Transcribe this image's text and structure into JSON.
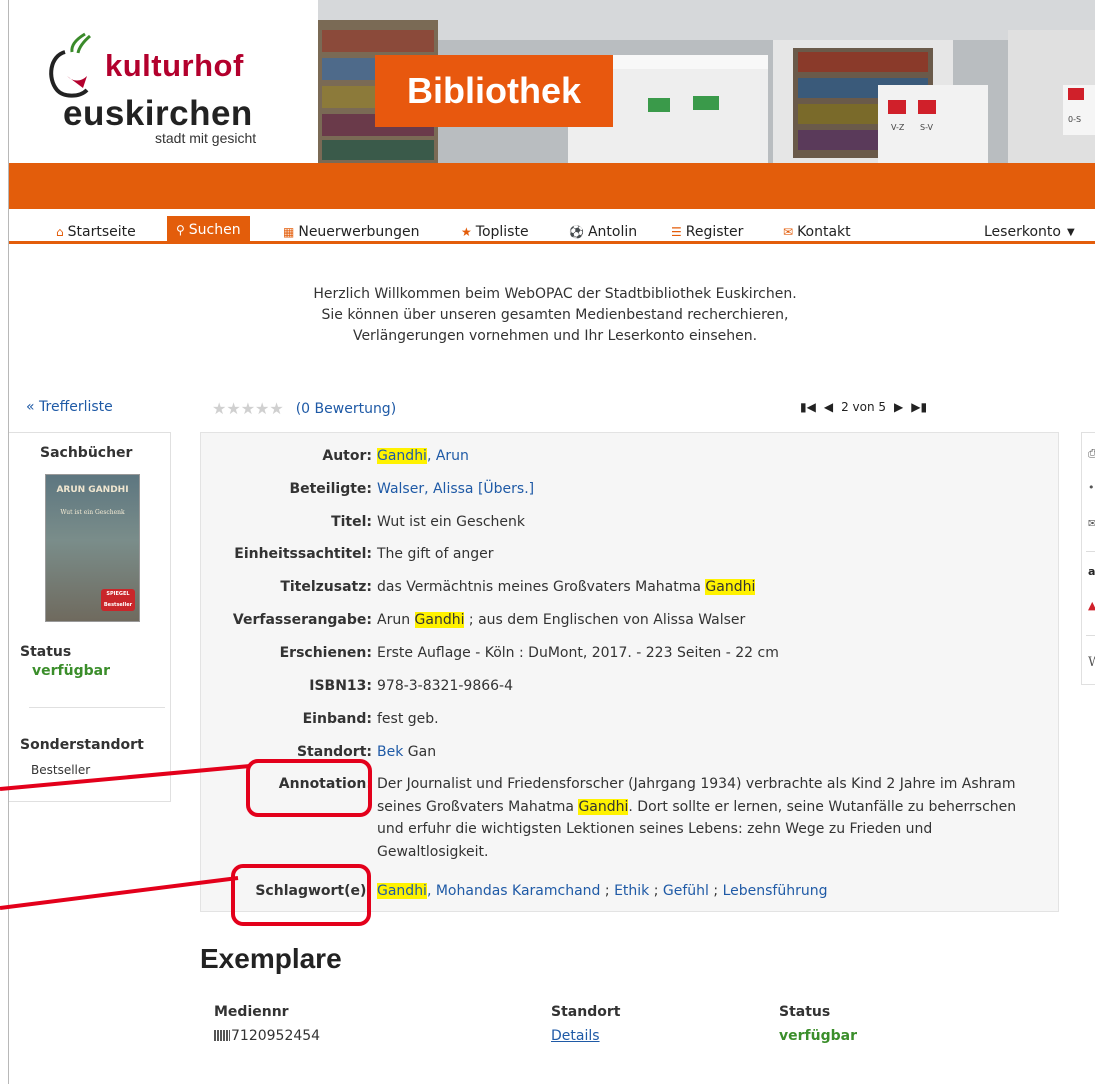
{
  "header": {
    "logo_kultur": "kulturhof",
    "logo_eusk": "euskirchen",
    "logo_stadt": "stadt mit gesicht",
    "banner_title": "Bibliothek",
    "shelf_labels": [
      "V-Z",
      "S-V",
      "0-S"
    ]
  },
  "nav": {
    "items": [
      {
        "label": "Startseite",
        "icon": "home-icon"
      },
      {
        "label": "Suchen",
        "icon": "search-icon"
      },
      {
        "label": "Neuerwerbungen",
        "icon": "calendar-icon"
      },
      {
        "label": "Topliste",
        "icon": "star-icon"
      },
      {
        "label": "Antolin",
        "icon": "ball-icon"
      },
      {
        "label": "Register",
        "icon": "list-icon"
      },
      {
        "label": "Kontakt",
        "icon": "envelope-icon"
      }
    ],
    "account": "Leserkonto",
    "active_color": "#e35d0b"
  },
  "welcome": {
    "line1": "Herzlich Willkommen beim WebOPAC der Stadtbibliothek Euskirchen.",
    "line2": "Sie können über unseren gesamten Medienbestand recherchieren,",
    "line3": "Verlängerungen vornehmen und Ihr Leserkonto einsehen."
  },
  "toolbar": {
    "back_link": "« Trefferliste",
    "rating_text": "(0 Bewertung)",
    "rating_stars": 0,
    "pager_text": "2 von 5"
  },
  "sidebar": {
    "category": "Sachbücher",
    "cover_author": "ARUN GANDHI",
    "cover_title": "Wut ist ein Geschenk",
    "cover_badge": "SPIEGEL Bestseller",
    "status_label": "Status",
    "status_value": "verfügbar",
    "sonder_label": "Sonderstandort",
    "sonder_value": "Bestseller"
  },
  "detail": {
    "autor_label": "Autor:",
    "autor_hl": "Gandhi",
    "autor_rest": ", Arun",
    "beteiligte_label": "Beteiligte:",
    "beteiligte_value": "Walser, Alissa [Übers.]",
    "titel_label": "Titel:",
    "titel_value": "Wut ist ein Geschenk",
    "einheit_label": "Einheitssachtitel:",
    "einheit_value": "The gift of anger",
    "zusatz_label": "Titelzusatz:",
    "zusatz_pre": "das Vermächtnis meines Großvaters Mahatma ",
    "zusatz_hl": "Gandhi",
    "verf_label": "Verfasserangabe:",
    "verf_pre": "Arun ",
    "verf_hl": "Gandhi",
    "verf_post": " ; aus dem Englischen von Alissa Walser",
    "ersch_label": "Erschienen:",
    "ersch_value": "Erste Auflage - Köln : DuMont, 2017. - 223 Seiten - 22 cm",
    "isbn_label": "ISBN13:",
    "isbn_value": "978-3-8321-9866-4",
    "einband_label": "Einband:",
    "einband_value": "fest geb.",
    "standort_label": "Standort:",
    "standort_link": "Bek",
    "standort_rest": " Gan",
    "anno_label": "Annotation:",
    "anno_pre": "Der Journalist und Friedensforscher (Jahrgang 1934) verbrachte als Kind 2 Jahre im Ashram seines Großvaters Mahatma ",
    "anno_hl": "Gandhi",
    "anno_post": ". Dort sollte er lernen, seine Wutanfälle zu beherrschen und erfuhr die wichtigsten Lektionen seines Lebens: zehn Wege zu Frieden und Gewaltlosigkeit.",
    "schlag_label": "Schlagwort(e):",
    "schlag_hl": "Gandhi",
    "schlag_1": ", Mohandas Karamchand",
    "schlag_sep": " ; ",
    "schlag_2": "Ethik",
    "schlag_3": "Gefühl",
    "schlag_4": "Lebensführung",
    "highlight_color": "#fff200"
  },
  "exemplare": {
    "title": "Exemplare",
    "col_mediennr": "Mediennr",
    "col_standort": "Standort",
    "col_status": "Status",
    "mediennr": "7120952454",
    "standort": "Details",
    "status": "verfügbar"
  }
}
